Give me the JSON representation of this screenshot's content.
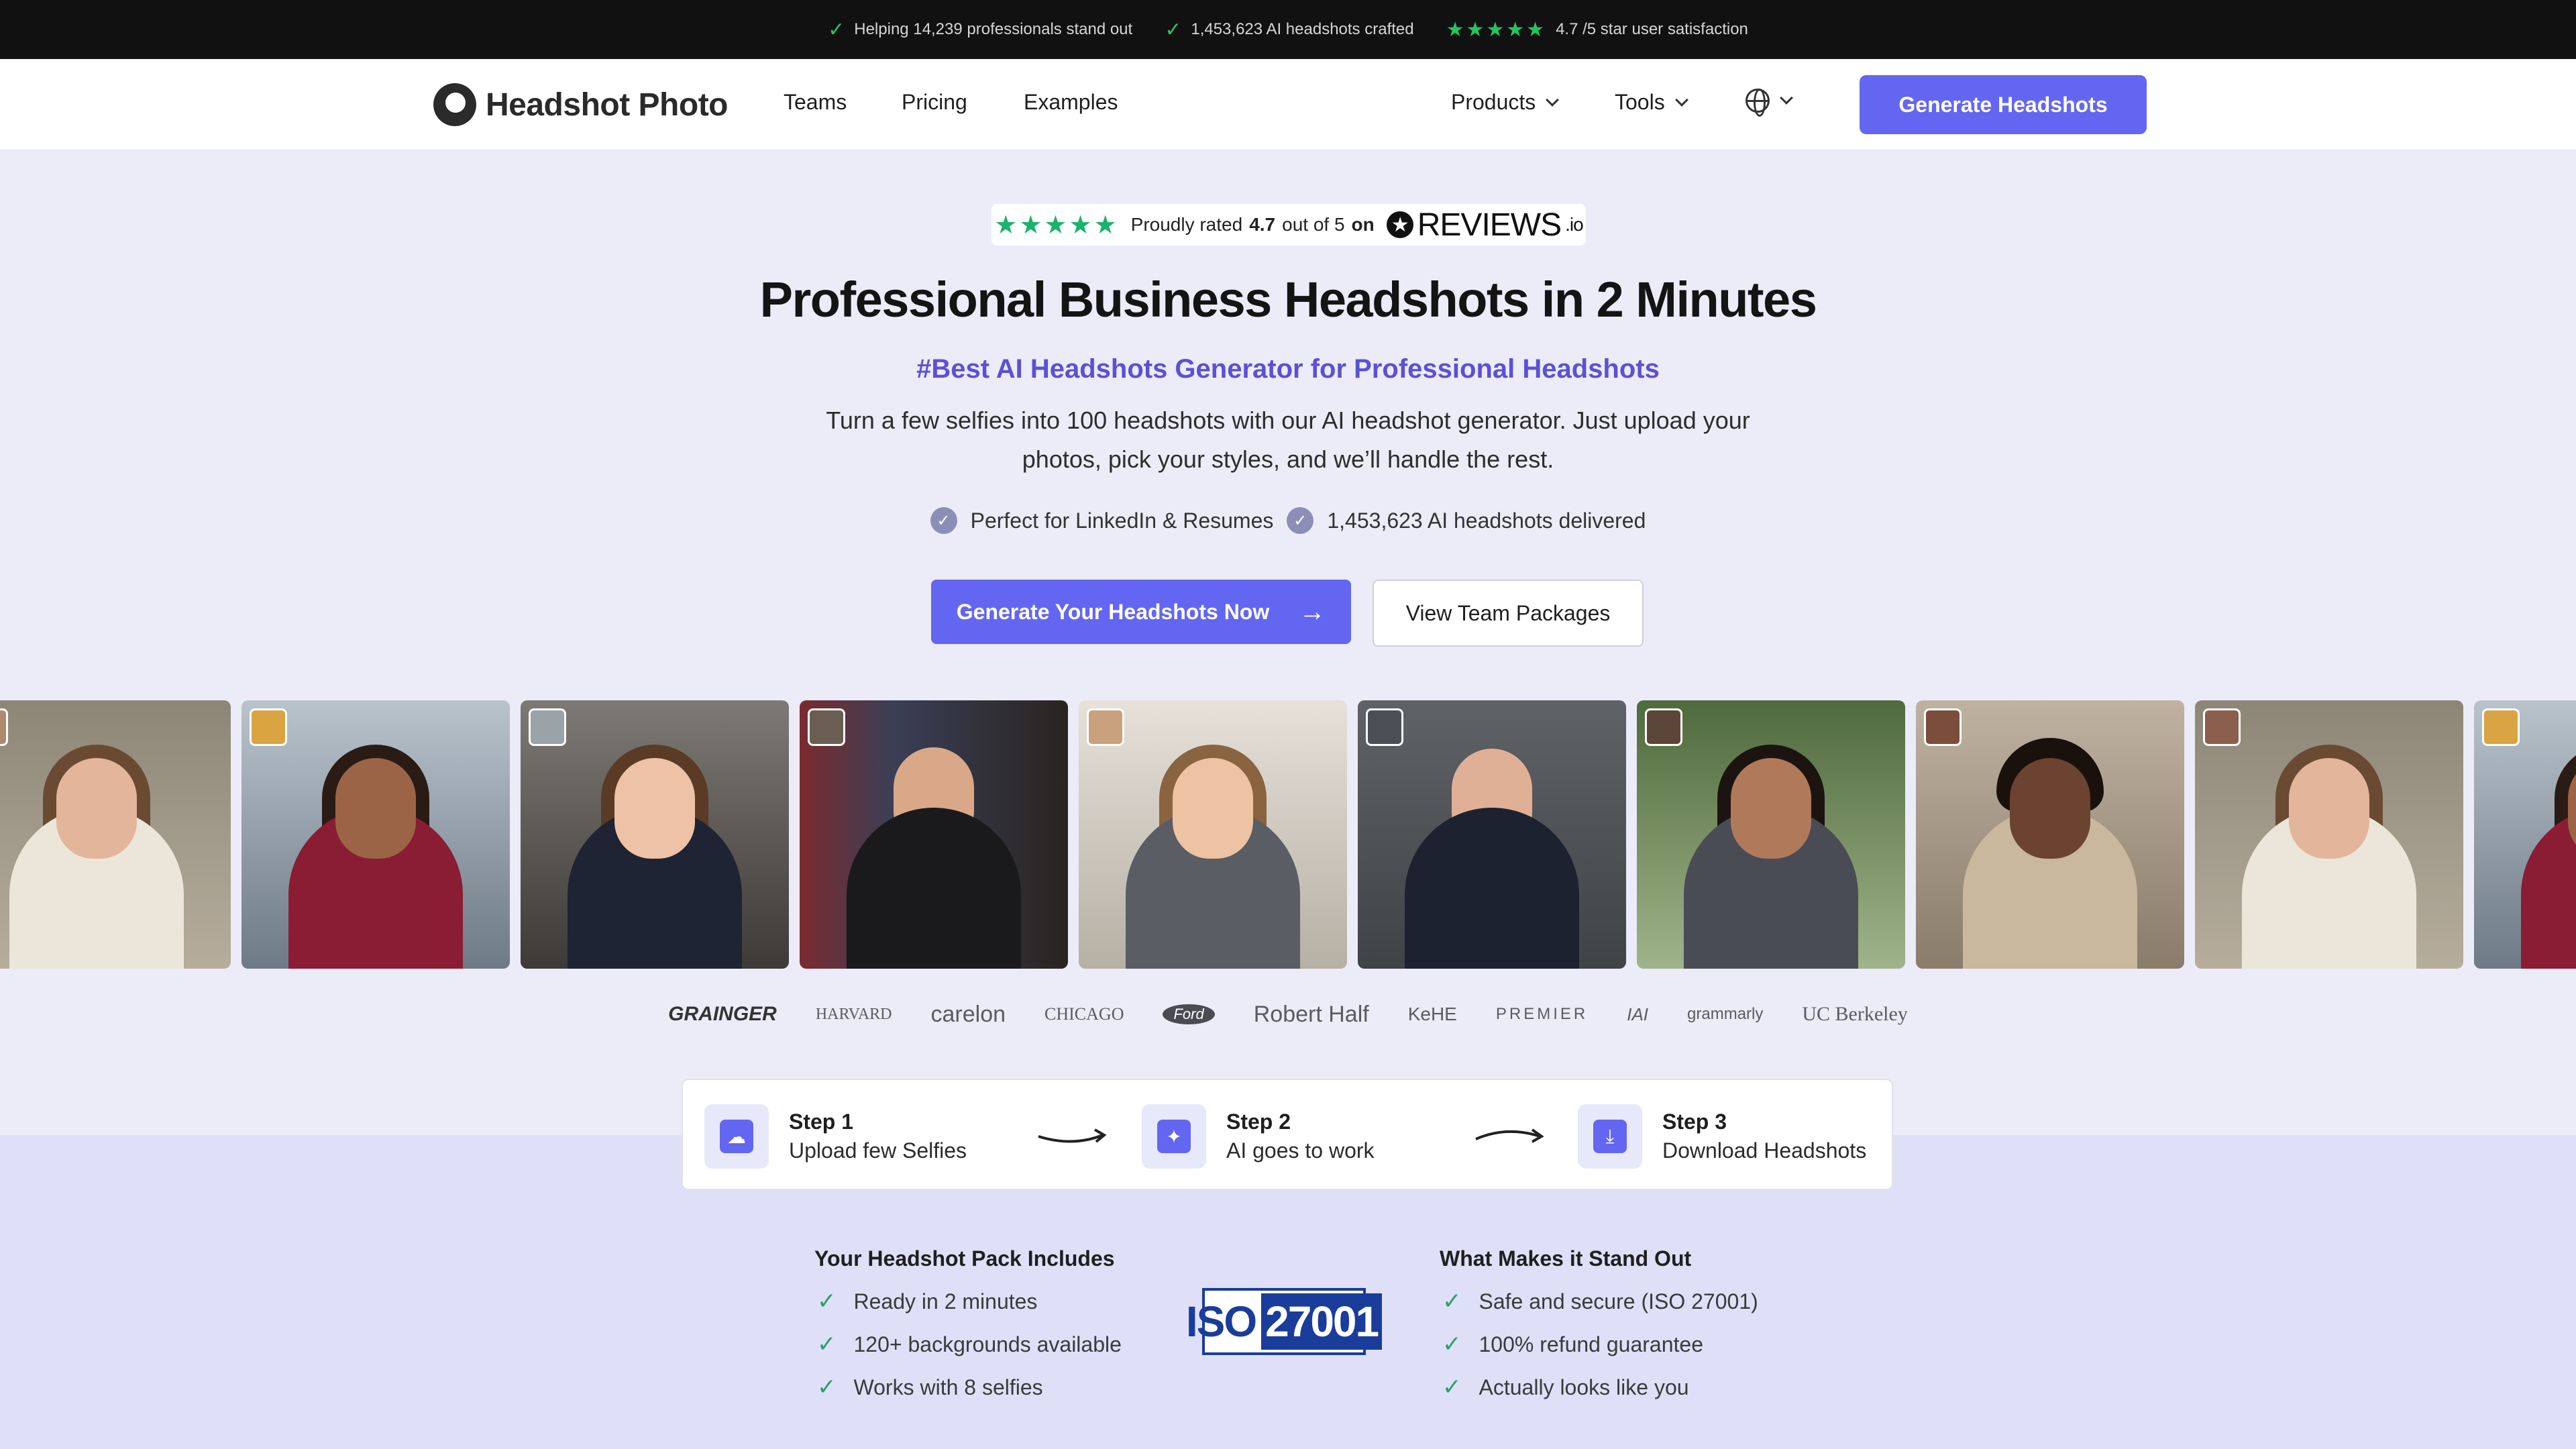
{
  "topbar": {
    "item1": "Helping 14,239 professionals stand out",
    "item2": "1,453,623 AI headshots crafted",
    "item3_stars": "★★★★★",
    "item3": "4.7 /5 star user satisfaction"
  },
  "nav": {
    "logo": "Headshot Photo",
    "links": [
      "Teams",
      "Pricing",
      "Examples"
    ],
    "products": "Products",
    "tools": "Tools",
    "cta": "Generate Headshots"
  },
  "rating": {
    "stars": "★★★★★",
    "prefix": "Proudly rated",
    "score": "4.7",
    "middle": "out of 5",
    "on": "on",
    "brand": "REVIEWS",
    "brand_suffix": ".io"
  },
  "hero": {
    "title": "Professional Business Headshots in 2 Minutes",
    "subtitle": "#Best AI Headshots Generator for Professional Headshots",
    "description": "Turn a few selfies into 100 headshots with our AI headshot generator. Just upload your photos, pick your styles, and we’ll handle the rest.",
    "bullet1": "Perfect for LinkedIn & Resumes",
    "bullet2": "1,453,623 AI headshots delivered",
    "cta_primary": "Generate Your Headshots Now",
    "cta_secondary": "View Team Packages"
  },
  "logos": [
    "GRAINGER",
    "HARVARD",
    "carelon",
    "CHICAGO",
    "Ford",
    "Robert Half",
    "KeHE",
    "PREMIER",
    "IAI",
    "grammarly",
    "UC Berkeley"
  ],
  "steps": [
    {
      "title": "Step 1",
      "text": "Upload few Selfies"
    },
    {
      "title": "Step 2",
      "text": "AI goes to work"
    },
    {
      "title": "Step 3",
      "text": "Download Headshots"
    }
  ],
  "pack": {
    "title": "Your Headshot Pack Includes",
    "items": [
      "Ready in 2 minutes",
      "120+ backgrounds available",
      "Works with 8 selfies"
    ]
  },
  "standout": {
    "title": "What Makes it Stand Out",
    "items": [
      "Safe and secure (ISO 27001)",
      "100% refund guarantee",
      "Actually looks like you"
    ]
  },
  "iso": {
    "left": "ISO",
    "right": "27001"
  },
  "colors": {
    "accent": "#6366f1",
    "subtitle": "#5b50d6",
    "star_green": "#22c55e"
  }
}
